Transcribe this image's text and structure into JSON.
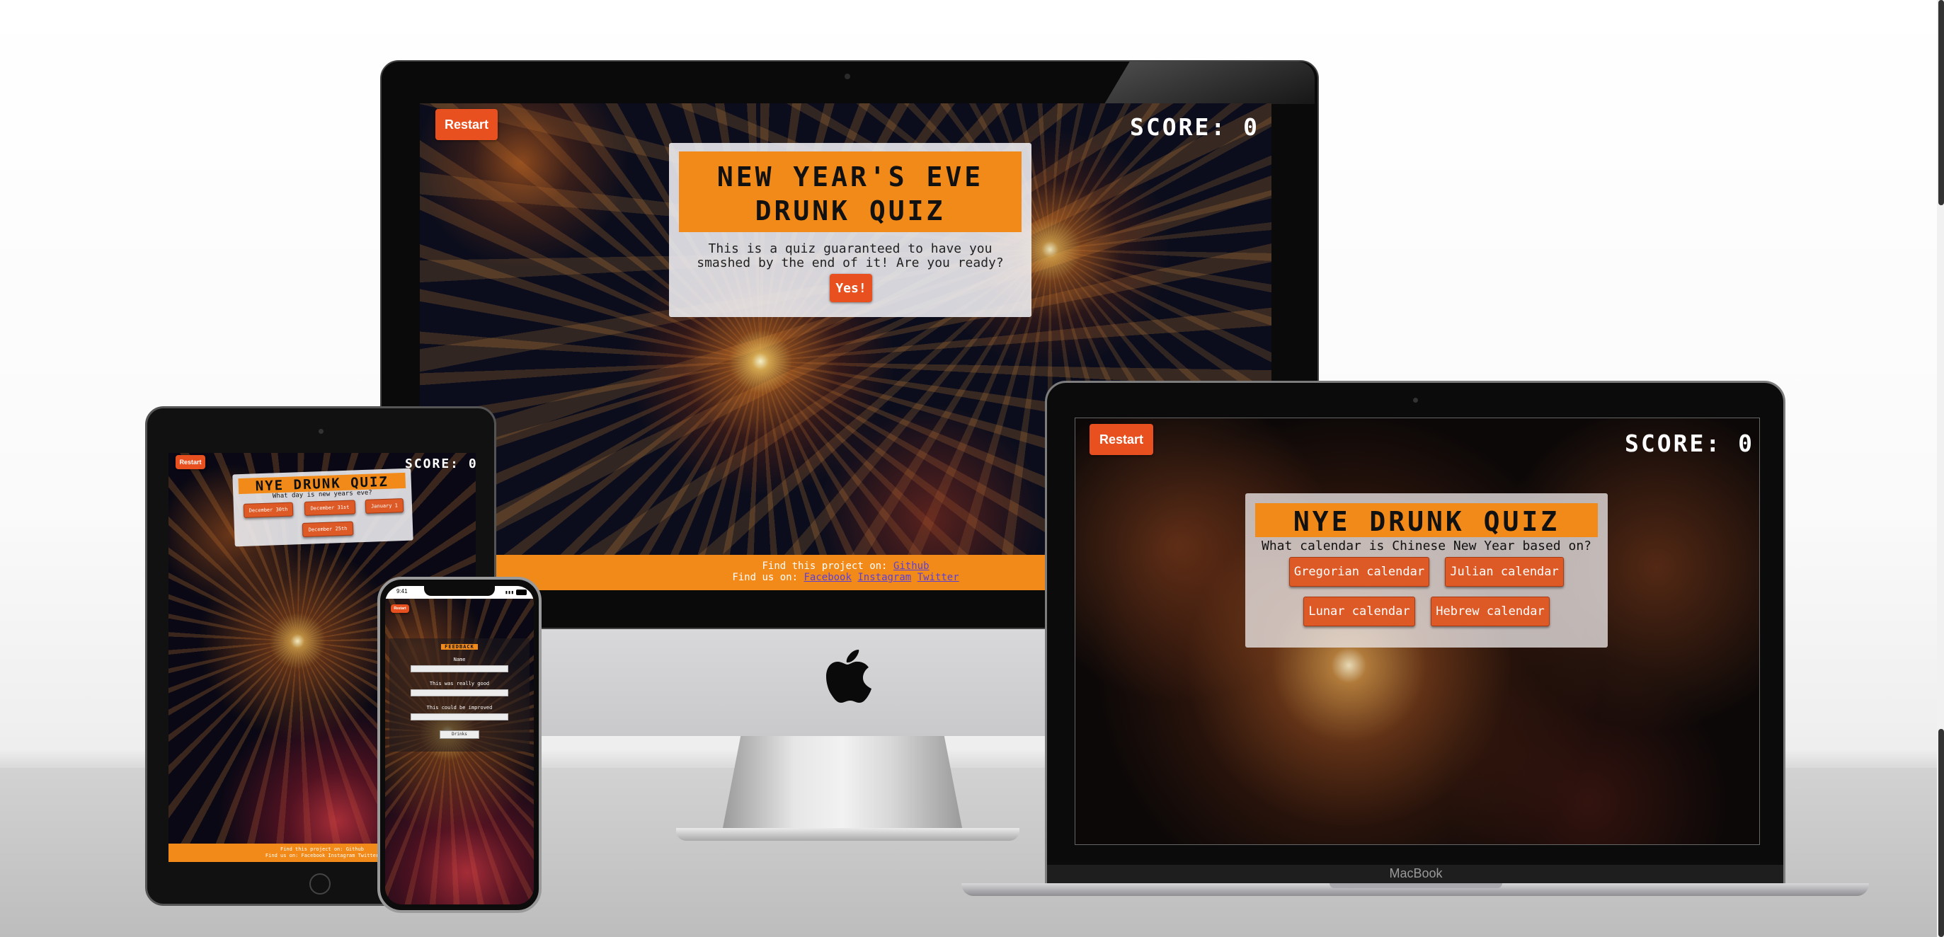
{
  "colors": {
    "accent_orange": "#f28a19",
    "button_red": "#e8511f",
    "answer_button": "#dd5a26",
    "link_purple": "#5b3fd8"
  },
  "imac": {
    "restart": "Restart",
    "score": "SCORE: 0",
    "title_line1": "NEW YEAR'S EVE",
    "title_line2": "DRUNK QUIZ",
    "intro": "This is a quiz guaranteed to have you smashed by the end of it! Are you ready?",
    "yes": "Yes!",
    "footer_project": "Find this project on:",
    "footer_github": "Github",
    "footer_find": "Find us on:",
    "footer_facebook": "Facebook",
    "footer_instagram": "Instagram",
    "footer_twitter": "Twitter"
  },
  "macbook": {
    "restart": "Restart",
    "score": "SCORE: 0",
    "title": "NYE DRUNK QUIZ",
    "question": "What calendar is Chinese New Year based on?",
    "answers": [
      "Gregorian calendar",
      "Julian calendar",
      "Lunar calendar",
      "Hebrew calendar"
    ],
    "brand": "MacBook"
  },
  "ipad": {
    "restart": "Restart",
    "score": "SCORE: 0",
    "title": "NYE DRUNK QUIZ",
    "question": "What day is new years eve?",
    "answers": [
      "December 30th",
      "December 31st",
      "January 1",
      "December 25th"
    ],
    "footer_project": "Find this project on: Github",
    "footer_find": "Find us on: Facebook Instagram Twitter"
  },
  "iphone": {
    "time": "9:41",
    "restart": "Restart",
    "feedback_title": "FEEDBACK",
    "name_label": "Name",
    "good_label": "This was really good",
    "improve_label": "This could be improved",
    "submit": "Drinks"
  }
}
